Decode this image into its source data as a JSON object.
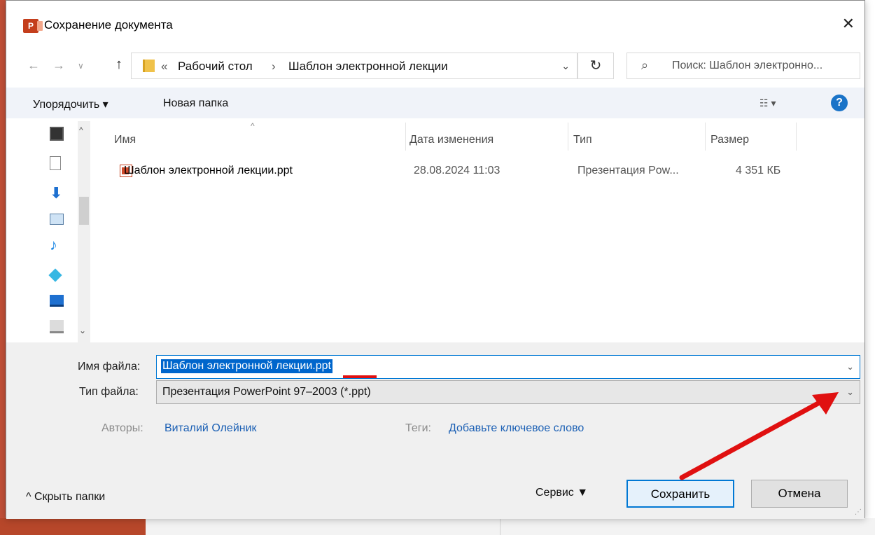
{
  "dialog": {
    "title": "Сохранение документа",
    "app_icon_letter": "P",
    "close_glyph": "✕"
  },
  "nav": {
    "back_glyph": "←",
    "forward_glyph": "→",
    "recent_glyph": "∨",
    "up_glyph": "↑",
    "breadcrumb_overflow": "«",
    "breadcrumb": [
      "Рабочий стол",
      "Шаблон электронной лекции"
    ],
    "breadcrumb_sep": "›",
    "refresh_glyph": "↻",
    "search_placeholder": "Поиск: Шаблон электронно..."
  },
  "toolbar": {
    "organize": "Упорядочить ▾",
    "new_folder": "Новая папка",
    "view_glyph": "☷ ▾",
    "help_glyph": "?"
  },
  "left_nav_icons": [
    "videos-icon",
    "documents-icon",
    "downloads-icon",
    "pictures-icon",
    "music-icon",
    "3d-objects-icon",
    "desktop-icon",
    "local-disk-icon"
  ],
  "columns": {
    "name": "Имя",
    "modified": "Дата изменения",
    "type": "Тип",
    "size": "Размер"
  },
  "files": [
    {
      "name": "Шаблон электронной лекции.ppt",
      "modified": "28.08.2024 11:03",
      "type": "Презентация Pow...",
      "size": "4 351 КБ"
    }
  ],
  "form": {
    "filename_label": "Имя файла:",
    "filename_value": "Шаблон электронной лекции.ppt",
    "filetype_label": "Тип файла:",
    "filetype_value": "Презентация PowerPoint 97–2003 (*.ppt)",
    "authors_label": "Авторы:",
    "authors_value": "Виталий Олейник",
    "tags_label": "Теги:",
    "tags_value": "Добавьте ключевое слово"
  },
  "footer": {
    "hide_folders": "^ Скрыть папки",
    "service": "Сервис  ▼",
    "save": "Сохранить",
    "cancel": "Отмена"
  },
  "colors": {
    "accent": "#0078d4",
    "annotation_red": "#e01010",
    "link": "#1a5fb4"
  }
}
